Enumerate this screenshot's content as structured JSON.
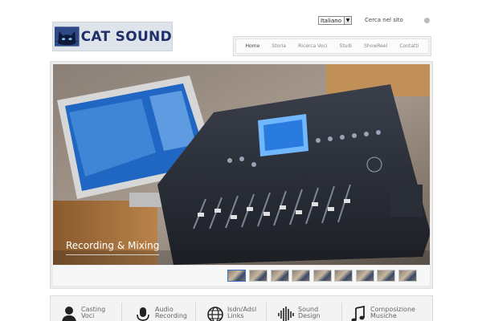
{
  "header": {
    "logo_text": "CAT SOUND",
    "language": "Italiano",
    "search_label": "Cerca nel sito"
  },
  "nav": {
    "items": [
      {
        "label": "Home",
        "active": true
      },
      {
        "label": "Storia",
        "active": false
      },
      {
        "label": "Ricerca Voci",
        "active": false
      },
      {
        "label": "Studi",
        "active": false
      },
      {
        "label": "ShowReel",
        "active": false
      },
      {
        "label": "Contatti",
        "active": false
      }
    ]
  },
  "slider": {
    "caption": "Recording & Mixing",
    "thumbnail_count": 9,
    "active_thumbnail": 1
  },
  "services": [
    {
      "line1": "Casting",
      "line2": "Voci",
      "icon": "person-silhouette-icon"
    },
    {
      "line1": "Audio",
      "line2": "Recording",
      "icon": "microphone-icon"
    },
    {
      "line1": "Isdn/Adsl",
      "line2": "Links",
      "icon": "globe-icon"
    },
    {
      "line1": "Sound",
      "line2": "Design",
      "icon": "waveform-icon"
    },
    {
      "line1": "Composizione",
      "line2": "Musiche",
      "icon": "music-note-icon"
    }
  ],
  "colors": {
    "logo_text": "#1e2f6b",
    "active_thumb_border": "#3d72c4",
    "console_screen": "#2f7ad0"
  }
}
